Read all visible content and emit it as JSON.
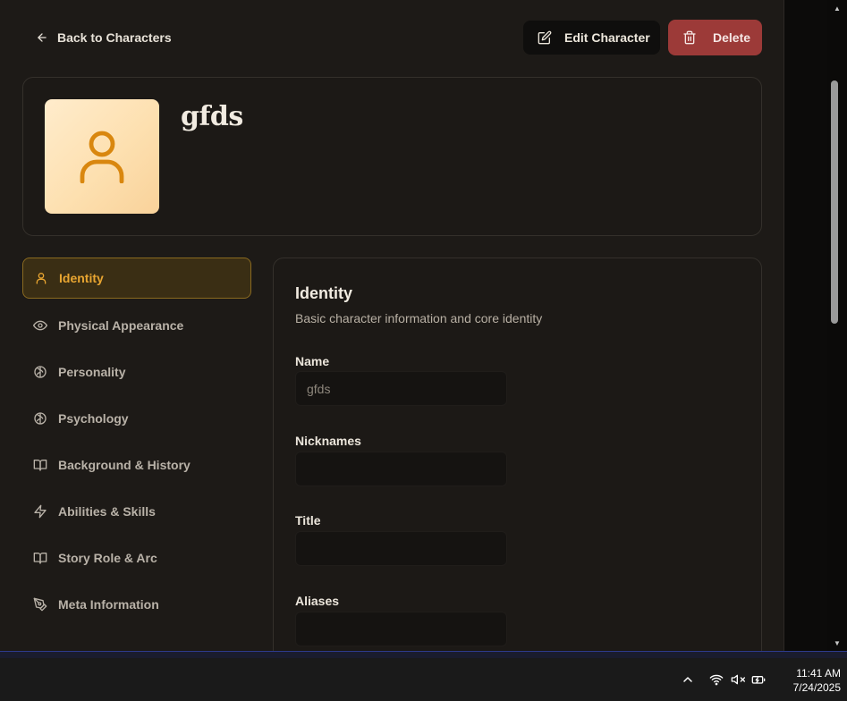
{
  "header": {
    "back_label": "Back to Characters",
    "edit_label": "Edit Character",
    "delete_label": "Delete"
  },
  "character": {
    "name": "gfds",
    "avatar_icon": "user-icon"
  },
  "sidebar": {
    "items": [
      {
        "label": "Identity",
        "icon": "user-icon",
        "active": true
      },
      {
        "label": "Physical Appearance",
        "icon": "eye-icon",
        "active": false
      },
      {
        "label": "Personality",
        "icon": "brain-icon",
        "active": false
      },
      {
        "label": "Psychology",
        "icon": "brain-icon",
        "active": false
      },
      {
        "label": "Background & History",
        "icon": "book-open-icon",
        "active": false
      },
      {
        "label": "Abilities & Skills",
        "icon": "zap-icon",
        "active": false
      },
      {
        "label": "Story Role & Arc",
        "icon": "book-open-icon",
        "active": false
      },
      {
        "label": "Meta Information",
        "icon": "pen-tool-icon",
        "active": false
      }
    ]
  },
  "section": {
    "title": "Identity",
    "subtitle": "Basic character information and core identity",
    "fields": [
      {
        "label": "Name",
        "value": "gfds",
        "placeholder": ""
      },
      {
        "label": "Nicknames",
        "value": "",
        "placeholder": ""
      },
      {
        "label": "Title",
        "value": "",
        "placeholder": ""
      },
      {
        "label": "Aliases",
        "value": "",
        "placeholder": ""
      }
    ]
  },
  "taskbar": {
    "time": "11:41 AM",
    "date": "7/24/2025",
    "tray_icons": [
      "chevron-up-icon",
      "wifi-icon",
      "speaker-muted-icon",
      "battery-charging-icon"
    ]
  },
  "colors": {
    "accent": "#e9a631",
    "danger": "#9c3a38",
    "background": "#1d1a17"
  }
}
